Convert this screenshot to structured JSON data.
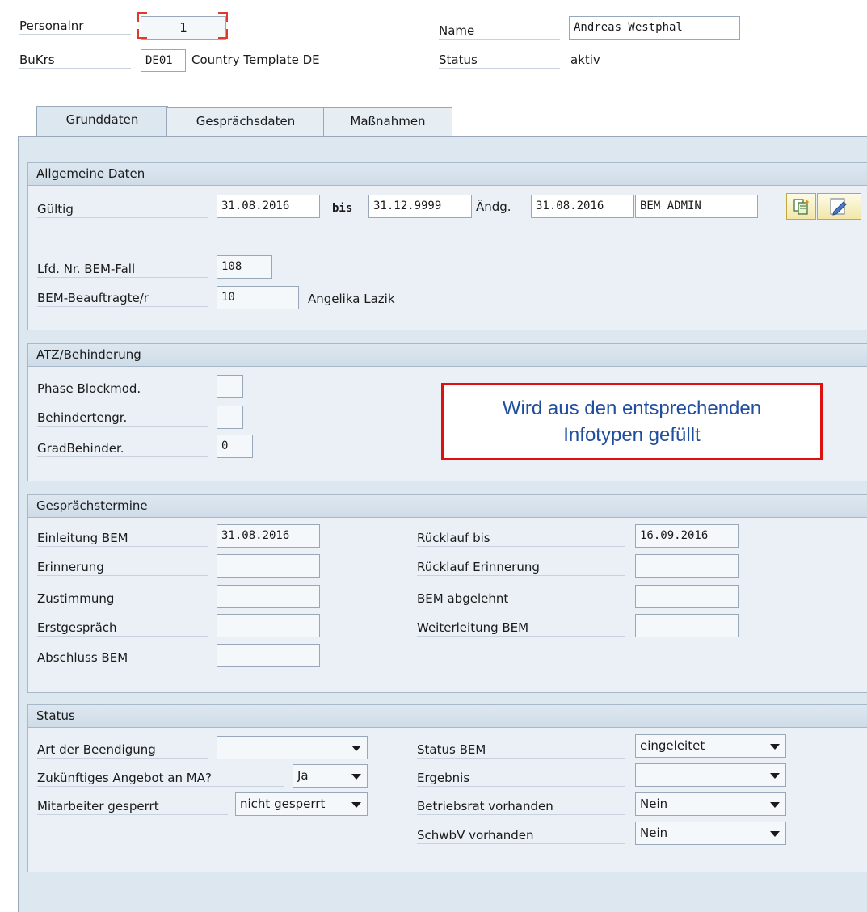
{
  "header": {
    "personalnr_label": "Personalnr",
    "personalnr_value": "1",
    "bukrs_label": "BuKrs",
    "bukrs_value": "DE01",
    "bukrs_text": "Country Template DE",
    "name_label": "Name",
    "name_value": "Andreas Westphal",
    "status_label": "Status",
    "status_value": "aktiv"
  },
  "tabs": [
    {
      "label": "Grunddaten",
      "active": true
    },
    {
      "label": "Gesprächsdaten",
      "active": false
    },
    {
      "label": "Maßnahmen",
      "active": false
    }
  ],
  "allgemeine": {
    "title": "Allgemeine Daten",
    "gueltig_label": "Gültig",
    "gueltig_from": "31.08.2016",
    "bis_label": "bis",
    "gueltig_to": "31.12.9999",
    "aendg_label": "Ändg.",
    "aendg_date": "31.08.2016",
    "aendg_user": "BEM_ADMIN",
    "lfd_label": "Lfd. Nr. BEM-Fall",
    "lfd_value": "108",
    "beauftragte_label": "BEM-Beauftragte/r",
    "beauftragte_value": "10",
    "beauftragte_name": "Angelika Lazik"
  },
  "atz": {
    "title": "ATZ/Behinderung",
    "phase_label": "Phase Blockmod.",
    "phase_value": "",
    "behindertengr_label": "Behindertengr.",
    "behindertengr_value": "",
    "grad_label": "GradBehinder.",
    "grad_value": "0"
  },
  "callout": {
    "line1": "Wird aus den entsprechenden",
    "line2": "Infotypen gefüllt",
    "border_color": "#e01010",
    "text_color": "#1f4e9e"
  },
  "termine": {
    "title": "Gesprächstermine",
    "left": [
      {
        "label": "Einleitung BEM",
        "value": "31.08.2016"
      },
      {
        "label": "Erinnerung",
        "value": ""
      },
      {
        "label": "Zustimmung",
        "value": ""
      },
      {
        "label": "Erstgespräch",
        "value": ""
      },
      {
        "label": "Abschluss BEM",
        "value": ""
      }
    ],
    "right": [
      {
        "label": "Rücklauf bis",
        "value": "16.09.2016"
      },
      {
        "label": "Rücklauf Erinnerung",
        "value": ""
      },
      {
        "label": "BEM abgelehnt",
        "value": ""
      },
      {
        "label": "Weiterleitung BEM",
        "value": ""
      }
    ]
  },
  "status": {
    "title": "Status",
    "art_label": "Art der Beendigung",
    "art_value": "",
    "angebot_label": "Zukünftiges Angebot an MA?",
    "angebot_value": "Ja",
    "gesperrt_label": "Mitarbeiter gesperrt",
    "gesperrt_value": "nicht gesperrt",
    "status_bem_label": "Status BEM",
    "status_bem_value": "eingeleitet",
    "ergebnis_label": "Ergebnis",
    "ergebnis_value": "",
    "betriebsrat_label": "Betriebsrat vorhanden",
    "betriebsrat_value": "Nein",
    "schwbv_label": "SchwbV vorhanden",
    "schwbv_value": "Nein"
  },
  "icons": [
    "change-documents-icon",
    "edit-icon"
  ]
}
